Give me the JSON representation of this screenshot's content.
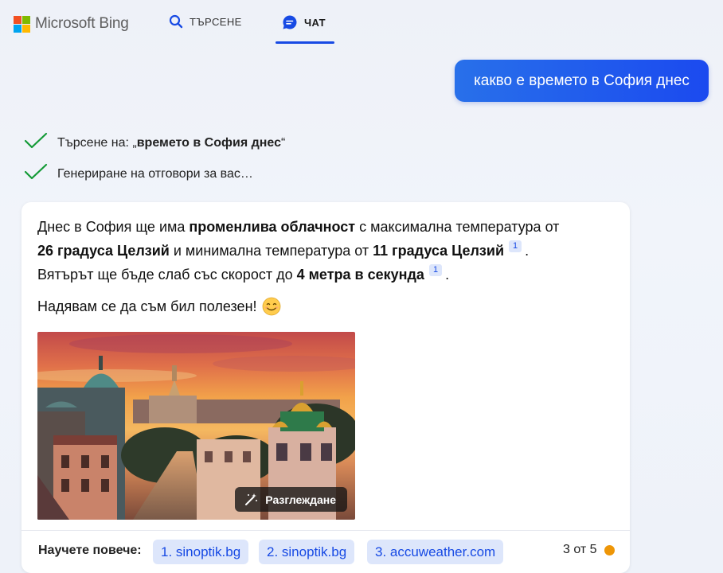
{
  "header": {
    "brand": "Microsoft Bing",
    "tabs": [
      {
        "label": "ТЪРСЕНЕ",
        "icon": "search-icon",
        "active": false
      },
      {
        "label": "ЧАТ",
        "icon": "chat-icon",
        "active": true
      }
    ]
  },
  "user_message": "какво е времето в София днес",
  "progress": [
    {
      "prefix": "Търсене на: „",
      "query": "времето в София днес",
      "suffix": "“",
      "icon": "checkmark-icon"
    },
    {
      "text": "Генериране на отговори за вас…",
      "icon": "checkmark-icon"
    }
  ],
  "answer": {
    "segments": {
      "s1": "Днес в София ще има ",
      "b1": "променлива облачност",
      "s2": " с максимална температура от ",
      "b2": "26 градуса Целзий",
      "s3": " и минимална температура от ",
      "b3": "11 градуса Целзий",
      "cite1": "1",
      "s4": ".",
      "s5": "Вятърът ще бъде слаб със скорост до ",
      "b4": "4 метра в секунда",
      "cite2": "1",
      "s6": "."
    },
    "closing": "Надявам се да съм бил полезен!",
    "closing_emoji": "smiling-face-icon",
    "image_button": "Разглеждане",
    "image_button_icon": "magic-wand-icon"
  },
  "footer": {
    "learn_more": "Научете повече:",
    "sources": [
      "1. sinoptik.bg",
      "2. sinoptik.bg",
      "3. accuweather.com"
    ],
    "counter": "3 от 5"
  },
  "colors": {
    "accent": "#174ae4",
    "chip_bg": "#dde6fb",
    "check": "#139a36",
    "counter_dot": "#ee9607"
  }
}
